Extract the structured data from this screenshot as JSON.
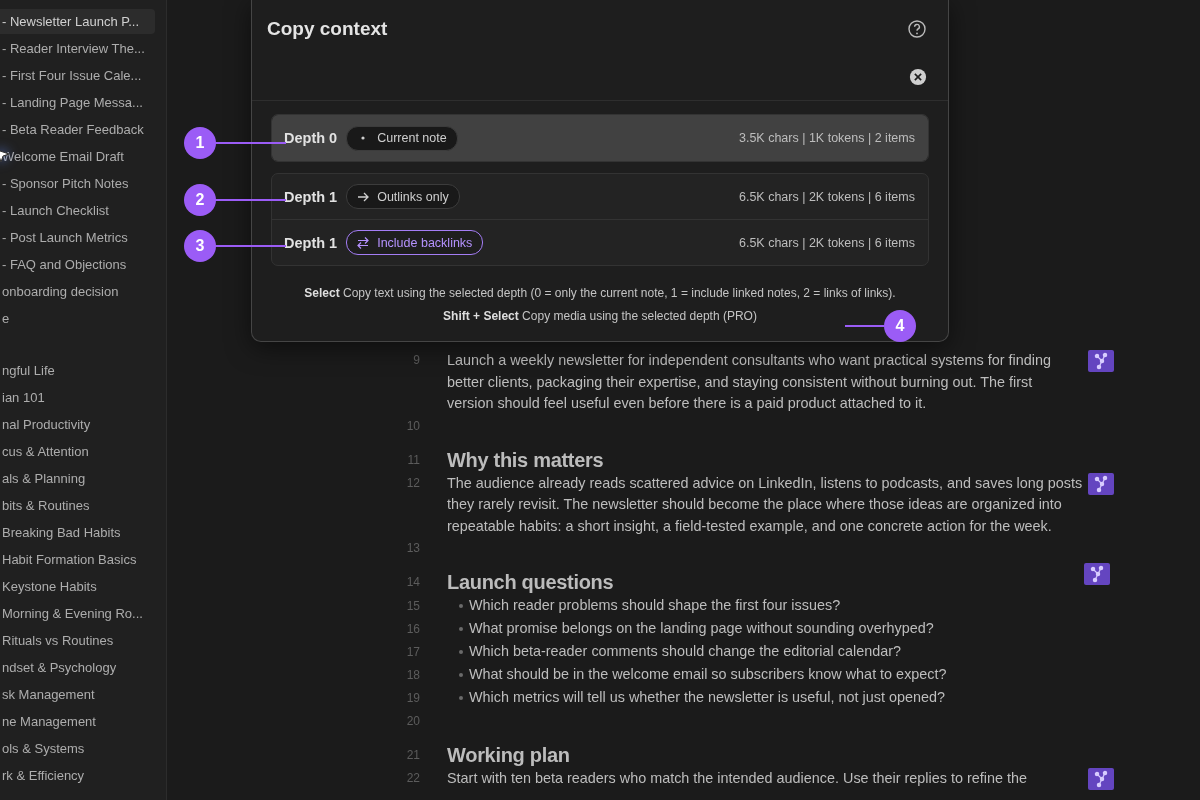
{
  "sidebar": {
    "groups": [
      {
        "items": [
          {
            "label": "- Newsletter Launch P...",
            "selected": true
          },
          {
            "label": "- Reader Interview The...",
            "selected": false
          },
          {
            "label": "- First Four Issue Cale...",
            "selected": false
          },
          {
            "label": "- Landing Page Messa...",
            "selected": false
          },
          {
            "label": "- Beta Reader Feedback",
            "selected": false
          },
          {
            "label": "Welcome Email Draft",
            "selected": false,
            "pointer": true
          },
          {
            "label": "- Sponsor Pitch Notes",
            "selected": false
          },
          {
            "label": "- Launch Checklist",
            "selected": false
          },
          {
            "label": "- Post Launch Metrics",
            "selected": false
          },
          {
            "label": "- FAQ and Objections",
            "selected": false
          },
          {
            "label": "onboarding decision",
            "selected": false
          },
          {
            "label": "e",
            "selected": false
          }
        ]
      },
      {
        "items": [
          {
            "label": "ngful Life",
            "selected": false
          },
          {
            "label": "ian 101",
            "selected": false
          },
          {
            "label": "nal Productivity",
            "selected": false
          },
          {
            "label": "cus & Attention",
            "selected": false
          },
          {
            "label": "als & Planning",
            "selected": false
          },
          {
            "label": "bits & Routines",
            "selected": false
          },
          {
            "label": "Breaking Bad Habits",
            "selected": false
          },
          {
            "label": "Habit Formation Basics",
            "selected": false
          },
          {
            "label": "Keystone Habits",
            "selected": false
          },
          {
            "label": "Morning & Evening Ro...",
            "selected": false
          },
          {
            "label": "Rituals vs Routines",
            "selected": false
          },
          {
            "label": "ndset & Psychology",
            "selected": false
          },
          {
            "label": "sk Management",
            "selected": false
          },
          {
            "label": "ne Management",
            "selected": false
          },
          {
            "label": "ols & Systems",
            "selected": false
          },
          {
            "label": "rk & Efficiency",
            "selected": false
          }
        ]
      }
    ]
  },
  "editor": {
    "lines": [
      {
        "number": "9",
        "kind": "paragraph",
        "text": "Launch a weekly newsletter for independent consultants who want practical systems for finding\nbetter clients, packaging their expertise, and staying consistent without burning out. The first\nversion should feel useful even before there is a paid product attached to it.",
        "graph_badge": true
      },
      {
        "number": "10",
        "kind": "blank",
        "graph_badge": false
      },
      {
        "number": "11",
        "kind": "heading",
        "text": "Why this matters",
        "graph_badge": false
      },
      {
        "number": "12",
        "kind": "paragraph",
        "text": "The audience already reads scattered advice on LinkedIn, listens to podcasts, and saves long posts\nthey rarely revisit. The newsletter should become the place where those ideas are organized into\nrepeatable habits: a short insight, a field-tested example, and one concrete action for the week.",
        "graph_badge": true
      },
      {
        "number": "13",
        "kind": "blank",
        "graph_badge": false
      },
      {
        "number": "14",
        "kind": "heading",
        "text": "Launch questions",
        "graph_badge": true
      },
      {
        "number": "15",
        "kind": "bullet",
        "text": "Which reader problems should shape the first four issues?",
        "graph_badge": false
      },
      {
        "number": "16",
        "kind": "bullet",
        "text": "What promise belongs on the landing page without sounding overhyped?",
        "graph_badge": false
      },
      {
        "number": "17",
        "kind": "bullet",
        "text": "Which beta-reader comments should change the editorial calendar?",
        "graph_badge": false
      },
      {
        "number": "18",
        "kind": "bullet",
        "text": "What should be in the welcome email so subscribers know what to expect?",
        "graph_badge": false
      },
      {
        "number": "19",
        "kind": "bullet",
        "text": "Which metrics will tell us whether the newsletter is useful, not just opened?",
        "graph_badge": false
      },
      {
        "number": "20",
        "kind": "blank",
        "graph_badge": false
      },
      {
        "number": "21",
        "kind": "heading",
        "text": "Working plan",
        "graph_badge": false
      },
      {
        "number": "22",
        "kind": "paragraph",
        "text": "Start with ten beta readers who match the intended audience. Use their replies to refine the",
        "graph_badge": true
      }
    ]
  },
  "dialog": {
    "title": "Copy context",
    "groups": [
      {
        "options": [
          {
            "depth": "Depth 0",
            "kind": "dot",
            "mode": "Current note",
            "active": false,
            "stats": "3.5K chars | 1K tokens | 2 items",
            "selected": true
          }
        ]
      },
      {
        "options": [
          {
            "depth": "Depth 1",
            "kind": "arrow",
            "mode": "Outlinks only",
            "active": false,
            "stats": "6.5K chars | 2K tokens | 6 items",
            "selected": false
          },
          {
            "depth": "Depth 1",
            "kind": "both",
            "mode": "Include backlinks",
            "active": true,
            "stats": "6.5K chars | 2K tokens | 6 items",
            "selected": false
          }
        ]
      }
    ],
    "hints": [
      "**Select** Copy text using the selected depth (0 = only the current note, 1 = include linked notes, 2 = links of links).",
      "**Shift + Select** Copy media using the selected depth (PRO)"
    ]
  },
  "callouts": [
    {
      "number": "1"
    },
    {
      "number": "2"
    },
    {
      "number": "3"
    },
    {
      "number": "4"
    }
  ]
}
